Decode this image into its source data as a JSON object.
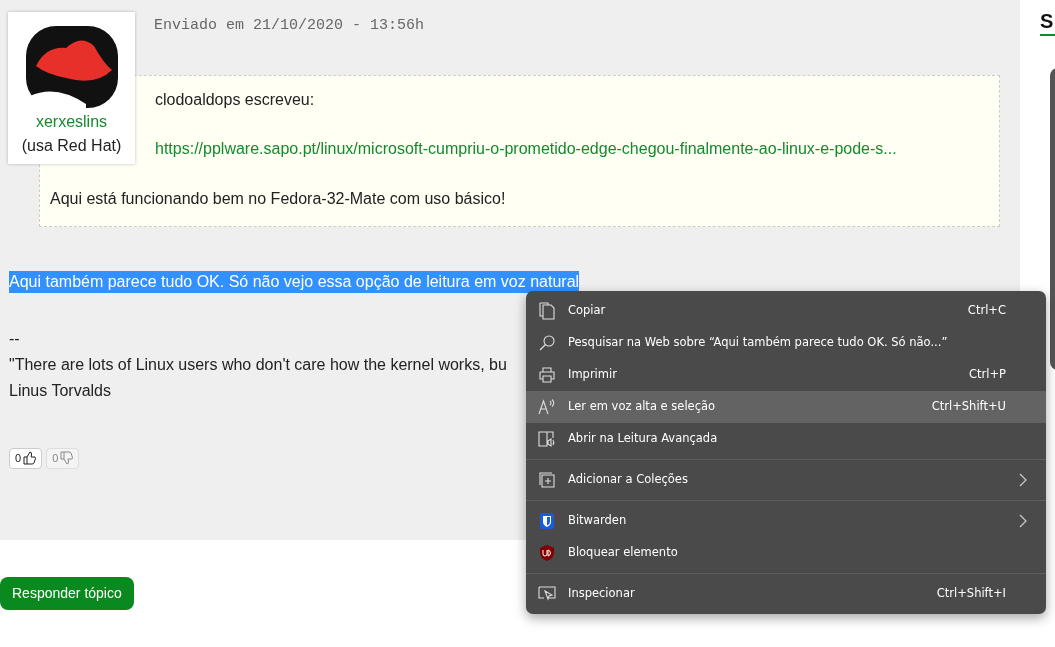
{
  "post": {
    "date": "Enviado em 21/10/2020 - 13:56h",
    "author": {
      "name": "xerxeslins",
      "distro": "(usa Red Hat)"
    },
    "quote": {
      "author_line": "clodoaldops escreveu:",
      "link": "https://pplware.sapo.pt/linux/microsoft-cumpriu-o-prometido-edge-chegou-finalmente-ao-linux-e-pode-s...",
      "text": "Aqui está funcionando bem no Fedora-32-Mate com uso básico!"
    },
    "selected_text": "Aqui também parece tudo OK. Só não vejo essa opção de leitura em voz natural",
    "signature": [
      "--",
      "\"There are lots of Linux users who don't care how the kernel works, bu",
      "Linus Torvalds"
    ],
    "votes": [
      {
        "kind": "up",
        "count": "0",
        "disabled": false
      },
      {
        "kind": "down",
        "count": "0",
        "disabled": true
      }
    ]
  },
  "reply_button": "Responder tópico",
  "sidebar": {
    "heading": "S"
  },
  "context_menu": {
    "groups": [
      [
        {
          "label": "Copiar",
          "shortcut": "Ctrl+C",
          "submenu": false,
          "selected": false
        },
        {
          "label": "Pesquisar na Web sobre “Aqui também parece tudo OK. Só não...”",
          "submenu": false,
          "selected": false
        },
        {
          "label": "Imprimir",
          "shortcut": "Ctrl+P",
          "submenu": false,
          "selected": false
        },
        {
          "label": "Ler em voz alta e seleção",
          "shortcut": "Ctrl+Shift+U",
          "submenu": false,
          "selected": true
        },
        {
          "label": "Abrir na Leitura Avançada",
          "submenu": false,
          "selected": false
        }
      ],
      [
        {
          "label": "Adicionar a Coleções",
          "submenu": true,
          "selected": false
        }
      ],
      [
        {
          "label": "Bitwarden",
          "submenu": true,
          "selected": false
        },
        {
          "label": "Bloquear elemento",
          "submenu": false,
          "selected": false
        }
      ],
      [
        {
          "label": "Inspecionar",
          "shortcut": "Ctrl+Shift+I",
          "submenu": false,
          "selected": false
        }
      ]
    ]
  }
}
